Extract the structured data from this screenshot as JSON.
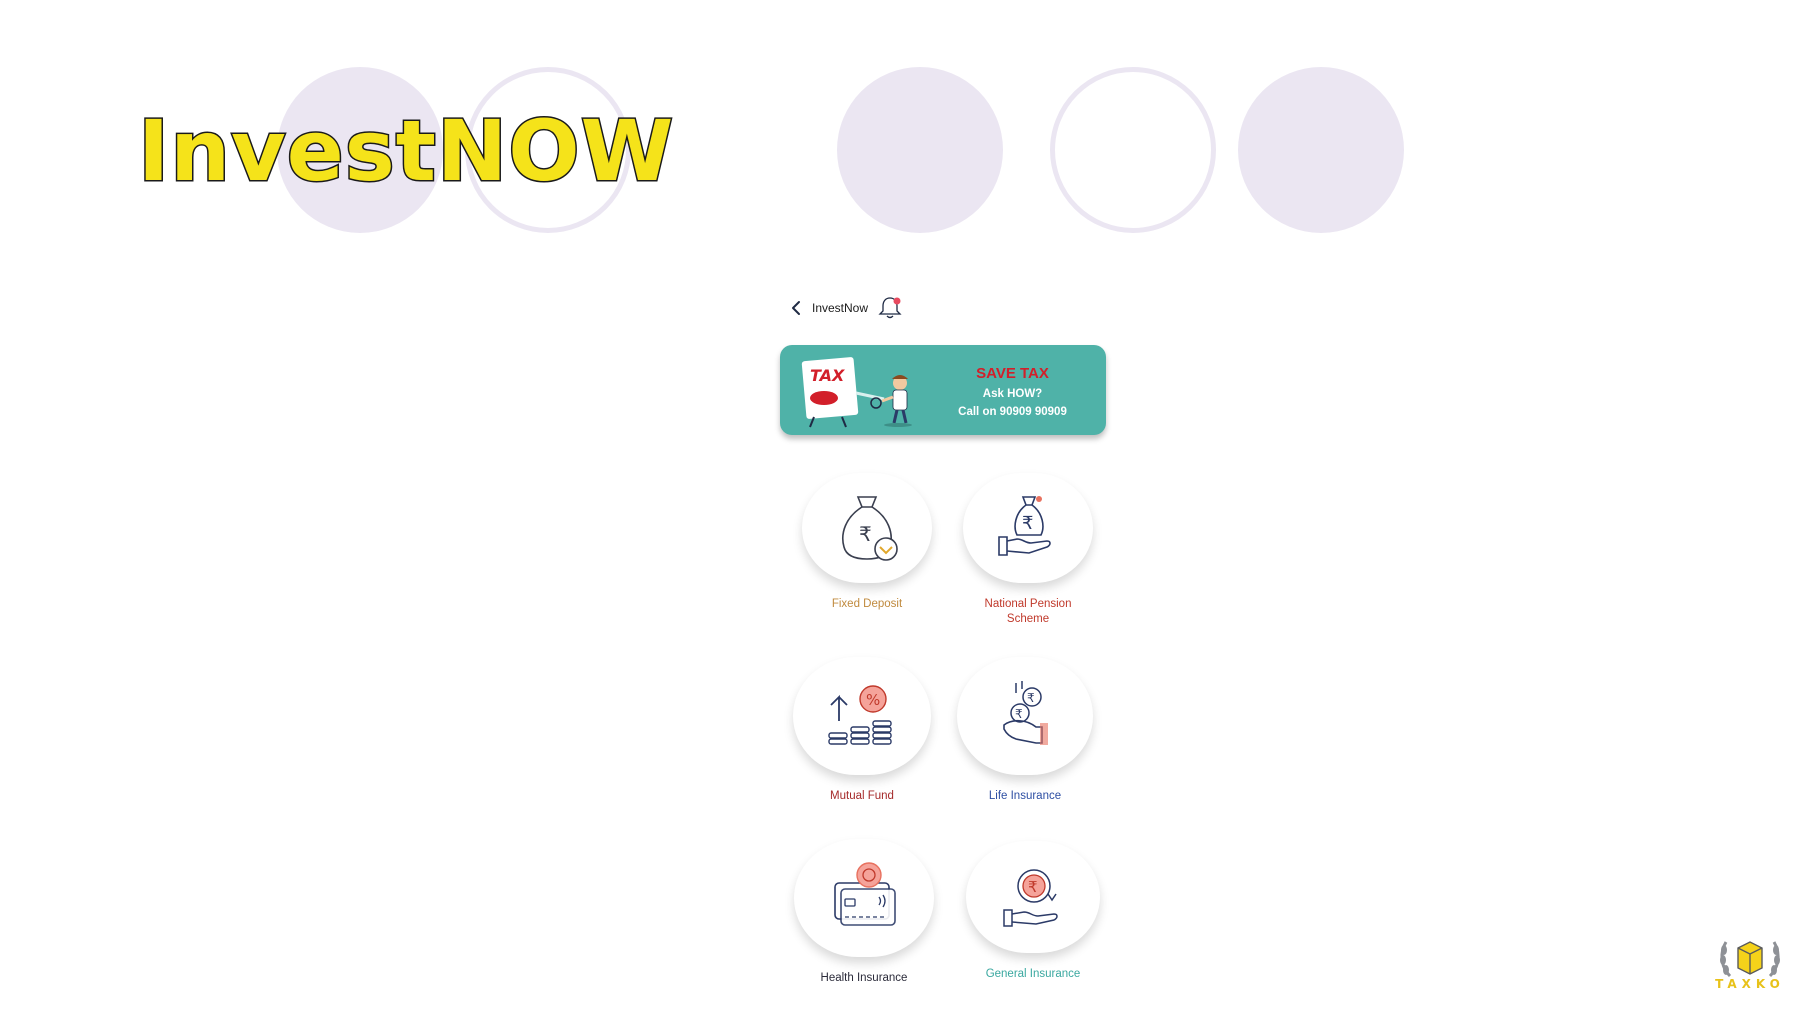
{
  "slide": {
    "title": "InvestNOW"
  },
  "logo": {
    "text": "TAXKO"
  },
  "header": {
    "title": "InvestNow"
  },
  "banner": {
    "art_label": "TAX",
    "headline": "SAVE TAX",
    "subline": "Ask HOW?",
    "call": "Call on 90909 90909"
  },
  "products": [
    {
      "label": "Fixed Deposit",
      "icon": "money-bag-icon",
      "color": "#c08a3e"
    },
    {
      "label": "National Pension\nScheme",
      "icon": "hand-money-bag-icon",
      "color": "#c0392b"
    },
    {
      "label": "Mutual Fund",
      "icon": "growth-percent-icon",
      "color": "#a52a2a"
    },
    {
      "label": "Life Insurance",
      "icon": "hand-coins-icon",
      "color": "#2e4fa3"
    },
    {
      "label": "Health Insurance",
      "icon": "health-card-icon",
      "color": "#2b2b3a"
    },
    {
      "label": "General Insurance",
      "icon": "rupee-hand-icon",
      "color": "#3aa8a0"
    }
  ],
  "colors": {
    "accent_teal": "#4fb2a8",
    "headline_red": "#d21f2a",
    "title_yellow": "#f5e31a",
    "deco_lavender": "#ebe6f2"
  }
}
